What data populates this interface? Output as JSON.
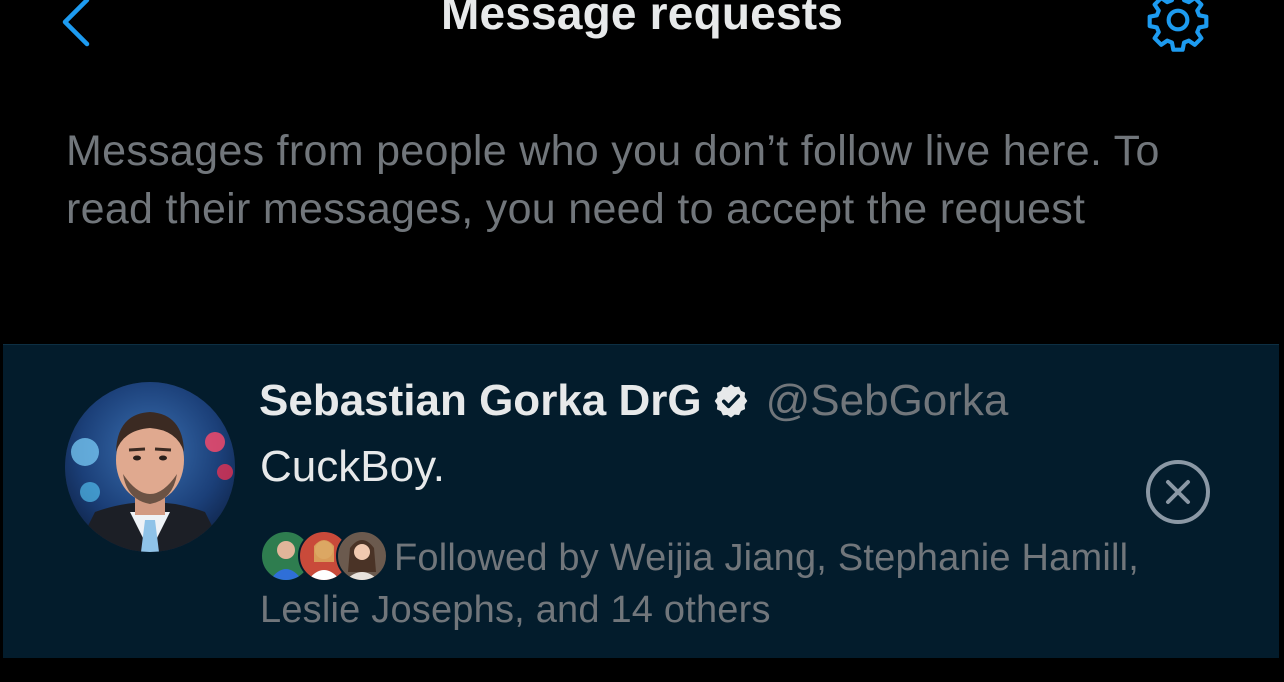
{
  "header": {
    "title": "Message requests",
    "back_icon": "chevron-left-icon",
    "settings_icon": "gear-icon"
  },
  "info": {
    "text": "Messages from people who you don’t follow live here. To read their messages, you need to accept the request"
  },
  "request": {
    "name": "Sebastian Gorka DrG",
    "verified_icon": "verified-badge-icon",
    "handle": "@SebGorka",
    "message": "CuckBoy.",
    "followed_by": "Followed by Weijia Jiang, Stephanie Hamill, Leslie Josephs, and 14 others",
    "dismiss_icon": "close-circle-icon"
  },
  "colors": {
    "background": "#000000",
    "accent": "#1d9bf0",
    "row_background": "#031c2c",
    "primary_text": "#e7e9ea",
    "secondary_text": "#71767b"
  }
}
